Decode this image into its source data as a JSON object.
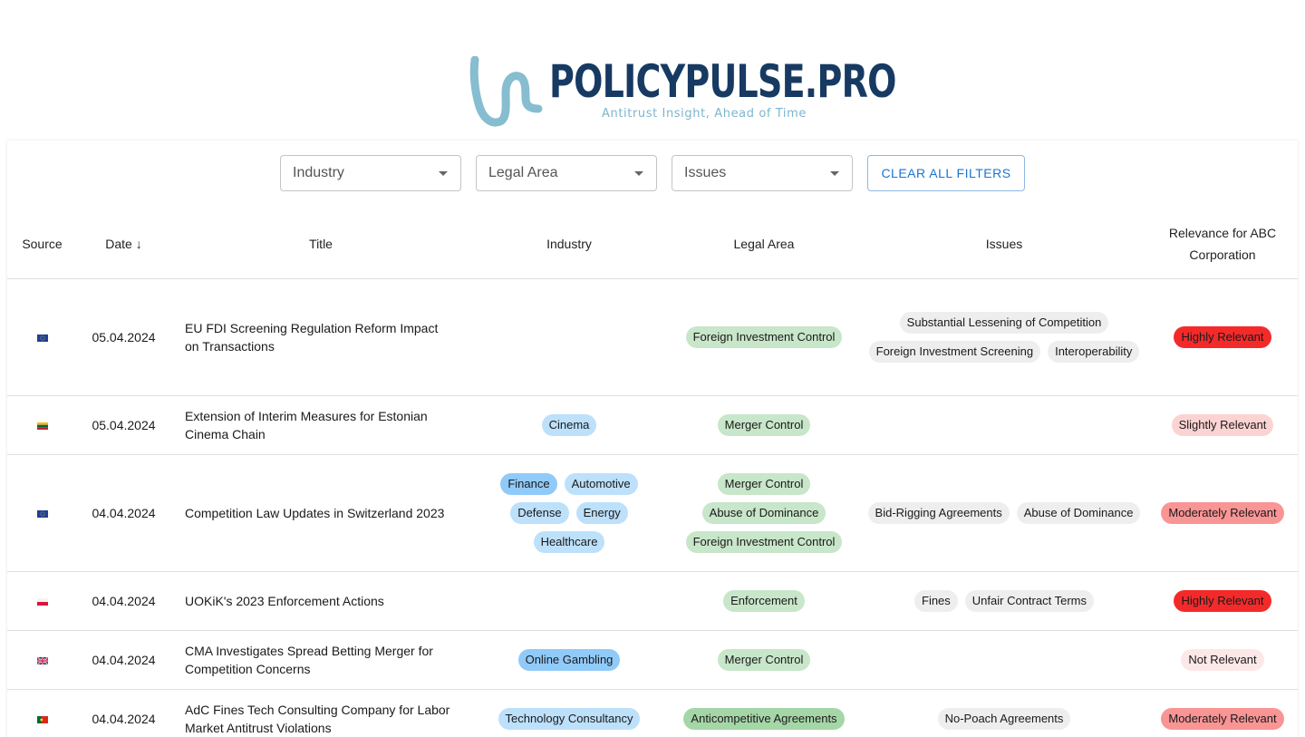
{
  "header": {
    "brand": "POLICYPULSE.PRO",
    "tagline": "Antitrust Insight, Ahead of Time",
    "colors": {
      "brand": "#173a63",
      "accent": "#7db5cc"
    }
  },
  "filters": {
    "industry": "Industry",
    "legal_area": "Legal Area",
    "issues": "Issues",
    "clear": "CLEAR ALL FILTERS"
  },
  "table": {
    "headers": {
      "source": "Source",
      "date": "Date ↓",
      "title": "Title",
      "industry": "Industry",
      "legal_area": "Legal Area",
      "issues": "Issues",
      "relevance_line1": "Relevance for ABC",
      "relevance_line2": "Corporation"
    },
    "rows": [
      {
        "flag": "eu-flag-icon",
        "date": "05.04.2024",
        "title_line1": "EU FDI Screening Regulation Reform Impact",
        "title_line2": "on Transactions",
        "industry": [],
        "legal": [
          "Foreign Investment Control"
        ],
        "issues": [
          "Substantial Lessening of Competition",
          "Foreign Investment Screening",
          "Interoperability"
        ],
        "relevance": "Highly Relevant",
        "relevance_color": "#f42a2a"
      },
      {
        "flag": "lithuania-flag-icon",
        "date": "05.04.2024",
        "title_line1": "Extension of Interim Measures for Estonian",
        "title_line2": "Cinema Chain",
        "industry": [
          "Cinema"
        ],
        "legal": [
          "Merger Control"
        ],
        "issues": [],
        "relevance": "Slightly Relevant",
        "relevance_color": "#fcd3d3"
      },
      {
        "flag": "eu-flag-icon",
        "date": "04.04.2024",
        "title_line1": "Competition Law Updates in Switzerland 2023",
        "title_line2": "",
        "industry": [
          "Finance",
          "Automotive",
          "Defense",
          "Energy",
          "Healthcare"
        ],
        "legal": [
          "Merger Control",
          "Abuse of Dominance",
          "Foreign Investment Control"
        ],
        "issues": [
          "Bid-Rigging Agreements",
          "Abuse of Dominance"
        ],
        "relevance": "Moderately Relevant",
        "relevance_color": "#f99595"
      },
      {
        "flag": "poland-flag-icon",
        "date": "04.04.2024",
        "title_line1": "UOKiK's 2023 Enforcement Actions",
        "title_line2": "",
        "industry": [],
        "legal": [
          "Enforcement"
        ],
        "issues": [
          "Fines",
          "Unfair Contract Terms"
        ],
        "relevance": "Highly Relevant",
        "relevance_color": "#f42a2a"
      },
      {
        "flag": "uk-flag-icon",
        "date": "04.04.2024",
        "title_line1": "CMA Investigates Spread Betting Merger for",
        "title_line2": "Competition Concerns",
        "industry": [
          "Online Gambling"
        ],
        "legal": [
          "Merger Control"
        ],
        "issues": [],
        "relevance": "Not Relevant",
        "relevance_color": "#fde8e8"
      },
      {
        "flag": "portugal-flag-icon",
        "date": "04.04.2024",
        "title_line1": "AdC Fines Tech Consulting Company for Labor",
        "title_line2": "Market Antitrust Violations",
        "industry": [
          "Technology Consultancy"
        ],
        "legal": [
          "Anticompetitive Agreements"
        ],
        "issues": [
          "No-Poach Agreements"
        ],
        "relevance": "Moderately Relevant",
        "relevance_color": "#f99595"
      }
    ]
  }
}
